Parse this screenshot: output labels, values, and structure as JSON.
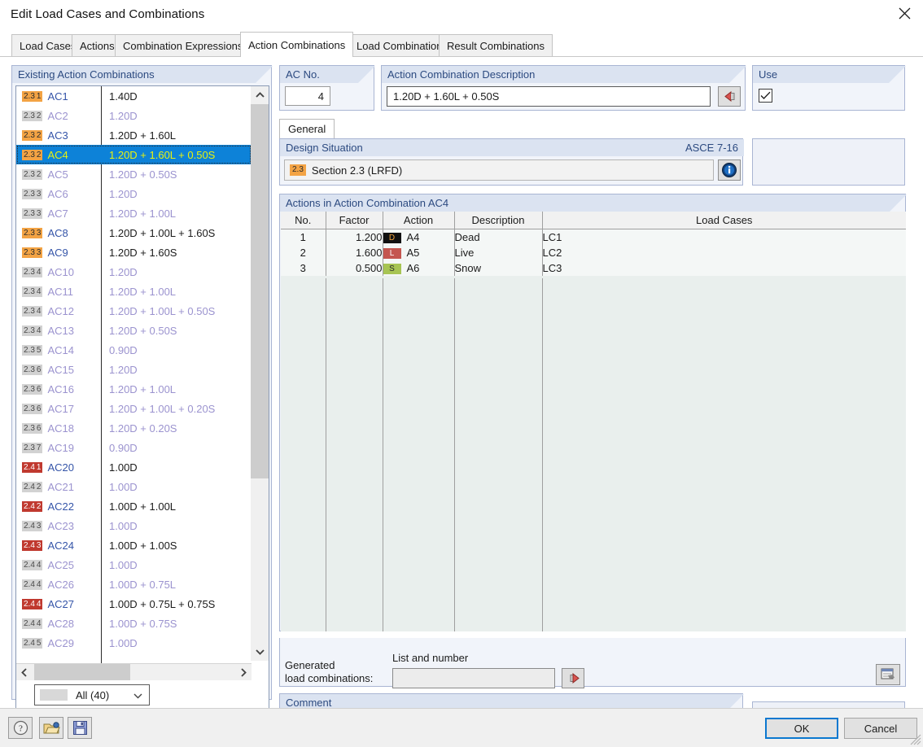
{
  "window": {
    "title": "Edit Load Cases and Combinations",
    "close_icon": "close-icon"
  },
  "tabs": [
    {
      "label": "Load Cases",
      "active": false
    },
    {
      "label": "Actions",
      "active": false
    },
    {
      "label": "Combination Expressions",
      "active": false
    },
    {
      "label": "Action Combinations",
      "active": true
    },
    {
      "label": "Load Combinations",
      "active": false
    },
    {
      "label": "Result Combinations",
      "active": false
    }
  ],
  "left_panel": {
    "title": "Existing Action Combinations",
    "filter": {
      "label": "All (40)",
      "chevron": "chevron-down-icon"
    },
    "scroll_up_icon": "chevron-up-icon",
    "scroll_down_icon": "chevron-down-icon",
    "scroll_left_icon": "chevron-left-icon",
    "scroll_right_icon": "chevron-right-icon",
    "rows": [
      {
        "sec": "2.3",
        "idx": "1",
        "name": "AC1",
        "desc": "1.40D",
        "hot": true,
        "red": false,
        "dim": false,
        "selected": false
      },
      {
        "sec": "2.3",
        "idx": "2",
        "name": "AC2",
        "desc": "1.20D",
        "hot": false,
        "red": false,
        "dim": true,
        "selected": false
      },
      {
        "sec": "2.3",
        "idx": "2",
        "name": "AC3",
        "desc": "1.20D + 1.60L",
        "hot": true,
        "red": false,
        "dim": false,
        "selected": false
      },
      {
        "sec": "2.3",
        "idx": "2",
        "name": "AC4",
        "desc": "1.20D + 1.60L + 0.50S",
        "hot": true,
        "red": false,
        "dim": false,
        "selected": true
      },
      {
        "sec": "2.3",
        "idx": "2",
        "name": "AC5",
        "desc": "1.20D + 0.50S",
        "hot": false,
        "red": false,
        "dim": true,
        "selected": false
      },
      {
        "sec": "2.3",
        "idx": "3",
        "name": "AC6",
        "desc": "1.20D",
        "hot": false,
        "red": false,
        "dim": true,
        "selected": false
      },
      {
        "sec": "2.3",
        "idx": "3",
        "name": "AC7",
        "desc": "1.20D + 1.00L",
        "hot": false,
        "red": false,
        "dim": true,
        "selected": false
      },
      {
        "sec": "2.3",
        "idx": "3",
        "name": "AC8",
        "desc": "1.20D + 1.00L + 1.60S",
        "hot": true,
        "red": false,
        "dim": false,
        "selected": false
      },
      {
        "sec": "2.3",
        "idx": "3",
        "name": "AC9",
        "desc": "1.20D + 1.60S",
        "hot": true,
        "red": false,
        "dim": false,
        "selected": false
      },
      {
        "sec": "2.3",
        "idx": "4",
        "name": "AC10",
        "desc": "1.20D",
        "hot": false,
        "red": false,
        "dim": true,
        "selected": false
      },
      {
        "sec": "2.3",
        "idx": "4",
        "name": "AC11",
        "desc": "1.20D + 1.00L",
        "hot": false,
        "red": false,
        "dim": true,
        "selected": false
      },
      {
        "sec": "2.3",
        "idx": "4",
        "name": "AC12",
        "desc": "1.20D + 1.00L + 0.50S",
        "hot": false,
        "red": false,
        "dim": true,
        "selected": false
      },
      {
        "sec": "2.3",
        "idx": "4",
        "name": "AC13",
        "desc": "1.20D + 0.50S",
        "hot": false,
        "red": false,
        "dim": true,
        "selected": false
      },
      {
        "sec": "2.3",
        "idx": "5",
        "name": "AC14",
        "desc": "0.90D",
        "hot": false,
        "red": false,
        "dim": true,
        "selected": false
      },
      {
        "sec": "2.3",
        "idx": "6",
        "name": "AC15",
        "desc": "1.20D",
        "hot": false,
        "red": false,
        "dim": true,
        "selected": false
      },
      {
        "sec": "2.3",
        "idx": "6",
        "name": "AC16",
        "desc": "1.20D + 1.00L",
        "hot": false,
        "red": false,
        "dim": true,
        "selected": false
      },
      {
        "sec": "2.3",
        "idx": "6",
        "name": "AC17",
        "desc": "1.20D + 1.00L + 0.20S",
        "hot": false,
        "red": false,
        "dim": true,
        "selected": false
      },
      {
        "sec": "2.3",
        "idx": "6",
        "name": "AC18",
        "desc": "1.20D + 0.20S",
        "hot": false,
        "red": false,
        "dim": true,
        "selected": false
      },
      {
        "sec": "2.3",
        "idx": "7",
        "name": "AC19",
        "desc": "0.90D",
        "hot": false,
        "red": false,
        "dim": true,
        "selected": false
      },
      {
        "sec": "2.4",
        "idx": "1",
        "name": "AC20",
        "desc": "1.00D",
        "hot": false,
        "red": true,
        "dim": false,
        "selected": false
      },
      {
        "sec": "2.4",
        "idx": "2",
        "name": "AC21",
        "desc": "1.00D",
        "hot": false,
        "red": false,
        "dim": true,
        "selected": false
      },
      {
        "sec": "2.4",
        "idx": "2",
        "name": "AC22",
        "desc": "1.00D + 1.00L",
        "hot": false,
        "red": true,
        "dim": false,
        "selected": false
      },
      {
        "sec": "2.4",
        "idx": "3",
        "name": "AC23",
        "desc": "1.00D",
        "hot": false,
        "red": false,
        "dim": true,
        "selected": false
      },
      {
        "sec": "2.4",
        "idx": "3",
        "name": "AC24",
        "desc": "1.00D + 1.00S",
        "hot": false,
        "red": true,
        "dim": false,
        "selected": false
      },
      {
        "sec": "2.4",
        "idx": "4",
        "name": "AC25",
        "desc": "1.00D",
        "hot": false,
        "red": false,
        "dim": true,
        "selected": false
      },
      {
        "sec": "2.4",
        "idx": "4",
        "name": "AC26",
        "desc": "1.00D + 0.75L",
        "hot": false,
        "red": false,
        "dim": true,
        "selected": false
      },
      {
        "sec": "2.4",
        "idx": "4",
        "name": "AC27",
        "desc": "1.00D + 0.75L + 0.75S",
        "hot": false,
        "red": true,
        "dim": false,
        "selected": false
      },
      {
        "sec": "2.4",
        "idx": "4",
        "name": "AC28",
        "desc": "1.00D + 0.75S",
        "hot": false,
        "red": false,
        "dim": true,
        "selected": false
      },
      {
        "sec": "2.4",
        "idx": "5",
        "name": "AC29",
        "desc": "1.00D",
        "hot": false,
        "red": false,
        "dim": true,
        "selected": false
      }
    ]
  },
  "ac_no": {
    "title": "AC No.",
    "value": "4"
  },
  "description": {
    "title": "Action Combination Description",
    "value": "1.20D + 1.60L + 0.50S",
    "button_icon": "back-arrow-icon"
  },
  "use": {
    "title": "Use",
    "checked": true,
    "check_icon": "check-icon"
  },
  "subtabs": [
    {
      "label": "General",
      "active": true
    }
  ],
  "design_situation": {
    "title": "Design Situation",
    "standard": "ASCE 7-16",
    "badge": "2.3",
    "value": "Section 2.3 (LRFD)",
    "info_icon": "info-icon"
  },
  "actions_table": {
    "title": "Actions in Action Combination AC4",
    "columns": [
      "No.",
      "Factor",
      "Action",
      "Description",
      "Load Cases"
    ],
    "rows": [
      {
        "no": "1",
        "factor": "1.200",
        "badge": "D",
        "badge_bg": "#111111",
        "badge_fg": "#f2a33c",
        "action": "A4",
        "desc": "Dead",
        "lc": "LC1"
      },
      {
        "no": "2",
        "factor": "1.600",
        "badge": "L",
        "badge_bg": "#c4564f",
        "badge_fg": "#ffffff",
        "action": "A5",
        "desc": "Live",
        "lc": "LC2"
      },
      {
        "no": "3",
        "factor": "0.500",
        "badge": "S",
        "badge_bg": "#a7c453",
        "badge_fg": "#2b2b2b",
        "action": "A6",
        "desc": "Snow",
        "lc": "LC3"
      }
    ]
  },
  "generated": {
    "label_line1": "Generated",
    "label_line2": "load combinations:",
    "sub_label": "List and number",
    "value": "",
    "go_button_icon": "red-arrow-right-icon",
    "settings_button_icon": "table-settings-icon"
  },
  "comment": {
    "title": "Comment",
    "value": "",
    "chevron": "chevron-down-icon",
    "button_icon": "copy-icon"
  },
  "footer": {
    "help_icon": "help-icon",
    "open_icon": "folder-open-icon",
    "save_icon": "save-icon",
    "ok_label": "OK",
    "cancel_label": "Cancel"
  }
}
